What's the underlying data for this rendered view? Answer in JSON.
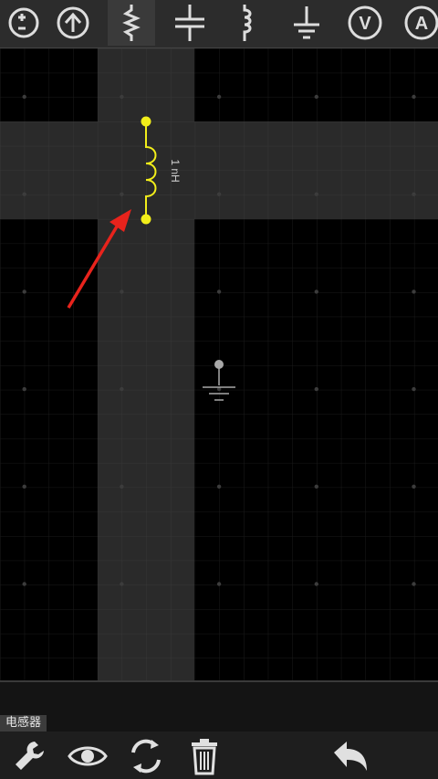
{
  "toolbar": {
    "tools": [
      {
        "name": "voltage-source-tool",
        "icon": "dc-source-icon"
      },
      {
        "name": "current-source-tool",
        "icon": "arrow-up-circle-icon"
      },
      {
        "name": "resistor-tool",
        "icon": "resistor-icon"
      },
      {
        "name": "capacitor-tool",
        "icon": "capacitor-icon"
      },
      {
        "name": "inductor-tool",
        "icon": "inductor-icon"
      },
      {
        "name": "ground-tool",
        "icon": "ground-icon"
      },
      {
        "name": "voltmeter-tool",
        "icon": "voltmeter-icon",
        "label": "V"
      },
      {
        "name": "ammeter-tool",
        "icon": "ammeter-icon",
        "label": "A"
      }
    ]
  },
  "circuit": {
    "inductor": {
      "value_label": "1 nH",
      "color": "#f2ee1a"
    },
    "ground": {
      "color": "#a8a8a8"
    }
  },
  "status": {
    "selected_label": "电感器"
  },
  "bottombar": {
    "buttons": [
      {
        "name": "settings-button",
        "icon": "wrench-icon"
      },
      {
        "name": "view-button",
        "icon": "eye-icon"
      },
      {
        "name": "rotate-button",
        "icon": "rotate-icon"
      },
      {
        "name": "delete-button",
        "icon": "trash-icon"
      },
      {
        "name": "undo-button",
        "icon": "undo-icon"
      }
    ]
  },
  "colors": {
    "accent": "#f2ee1a",
    "arrow": "#e8231c",
    "grid": "#1b1b1b",
    "highlight": "#2a2a2a"
  }
}
